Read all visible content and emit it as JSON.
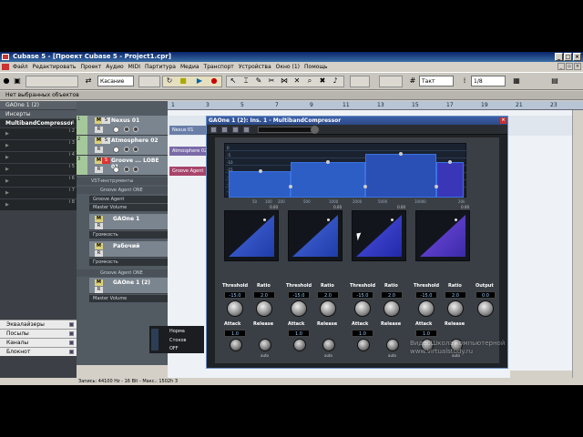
{
  "window": {
    "title": "Cubase 5 - [Проект Cubase 5 - Project1.cpr]"
  },
  "menu": [
    "Файл",
    "Редактировать",
    "Проект",
    "Аудио",
    "MIDI",
    "Партитура",
    "Медиа",
    "Транспорт",
    "Устройства",
    "Окно (1)",
    "Помощь"
  ],
  "toolbar": {
    "automation_mode": "Касание",
    "snap_mode": "Такт",
    "quantize": "1/8"
  },
  "infoline": "Нет выбранных объектов",
  "inspector": {
    "track_name": "GAOne 1 (2)",
    "section_inserts": "Инсерты",
    "slot1": "MultibandCompressor",
    "slot_numbers": [
      "i 1",
      "i 2",
      "i 3",
      "i 4",
      "i 5",
      "i 6",
      "i 7",
      "i 8"
    ],
    "bottom": [
      "Эквалайзеры",
      "Посылы",
      "Каналы",
      "Блокнот"
    ]
  },
  "tracks": [
    {
      "num": "1",
      "name": "Nexus 01"
    },
    {
      "num": "2",
      "name": "Atmosphere 02"
    },
    {
      "num": "3",
      "name": "Groove ... LOBE 01"
    }
  ],
  "subtracks": {
    "vst_folder": "VST-инструменты",
    "groove_agent": "Groove Agent ONE",
    "groove_agent_short": "Groove Agent",
    "master_volume": "Master Volume",
    "gaone1": "GAOne 1",
    "volume": "Громкость",
    "work": "Рабочий",
    "groove_agent_one2": "Groove Agent ONE",
    "gaone1_2": "GAOne 1 (2)",
    "volume2": "Громкость",
    "master_volume2": "Master Volume"
  },
  "status": "Запись: 44100 Hz - 16 Bit - Макс.: 1502h 3",
  "ruler": [
    "1",
    "3",
    "5",
    "7",
    "9",
    "11",
    "13",
    "15",
    "17",
    "19",
    "21",
    "23"
  ],
  "events": [
    "Nexus 01",
    "Atmosphere 02",
    "Groove Agent ONE"
  ],
  "mini_panel": {
    "line1": "Норма",
    "line2": "Стоков",
    "line3": "OFF"
  },
  "plugin": {
    "title": "GAOne 1 (2): Ins. 1 - MultibandCompressor",
    "db_labels": [
      "0",
      "-5",
      "-10",
      "-15",
      "-20",
      "-25",
      "-30",
      "-35"
    ],
    "freq_labels": [
      "50",
      "100",
      "200",
      "500",
      "1000",
      "2000",
      "5000",
      "10000",
      "20k"
    ],
    "bands": [
      {
        "curve_label": "0.00",
        "threshold": "-15.0",
        "ratio": "2.0",
        "attack": "1.0"
      },
      {
        "curve_label": "0.00",
        "threshold": "-15.0",
        "ratio": "2.0",
        "attack": "1.0"
      },
      {
        "curve_label": "0.00",
        "threshold": "-15.0",
        "ratio": "2.0",
        "attack": "1.0"
      },
      {
        "curve_label": "0.00",
        "threshold": "-15.0",
        "ratio": "2.0",
        "attack": "1.0"
      }
    ],
    "labels": {
      "threshold": "Threshold",
      "ratio": "Ratio",
      "attack": "Attack",
      "release": "Release",
      "output": "Output",
      "auto": "auto"
    },
    "output_value": "0.0"
  },
  "watermark": {
    "line1": "ВидеоШкола компьютерной",
    "line2": "www.virtualstudy.ru"
  },
  "colors": {
    "band": "#2c5ec6",
    "titlebar": "#0a246a"
  }
}
